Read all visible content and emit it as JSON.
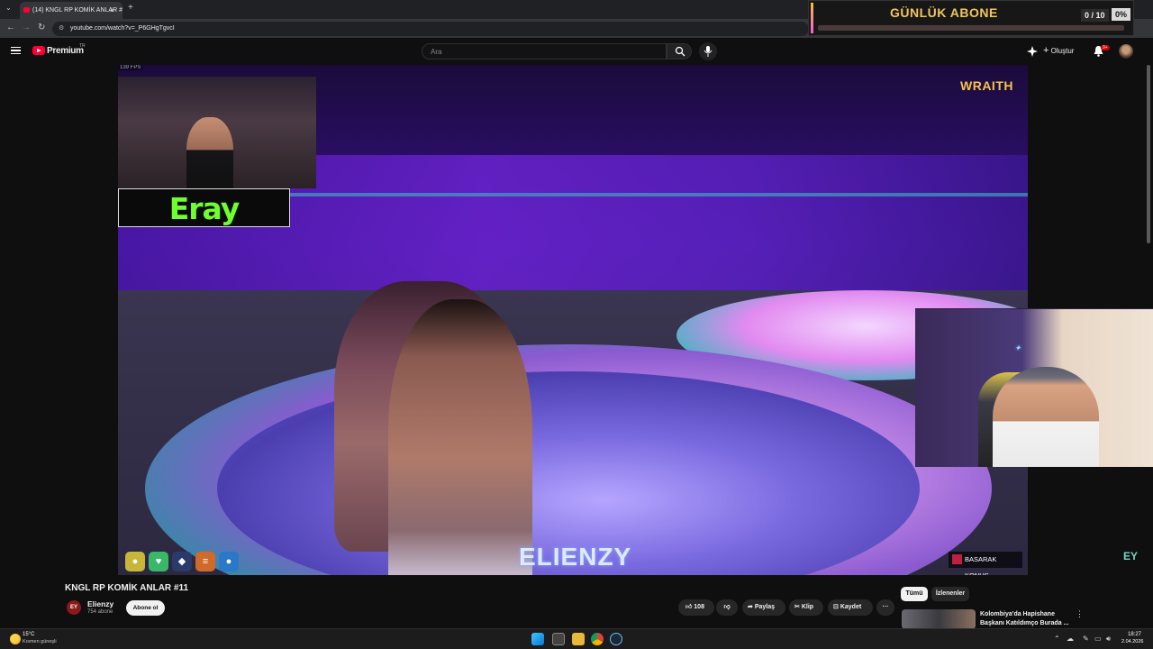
{
  "browser": {
    "tab_title": "(14) KNGL RP KOMİK ANLAR #",
    "url": "youtube.com/watch?v=_P6GHgTgvcI"
  },
  "overlay": {
    "title": "GÜNLÜK ABONE",
    "count": "0 / 10",
    "percent": "0%",
    "progress": 0
  },
  "header": {
    "brand": "Premium",
    "country": "TR",
    "search_placeholder": "Ara",
    "create_label": "Oluştur",
    "notification_count": "9+"
  },
  "video": {
    "fps": "139 FPS",
    "streamer_name": "Eray",
    "sponsor": "WRAITH",
    "character_name": "ELIENZY",
    "speaking_label": "BASARAK KONUŞ",
    "channel_mark": "EY"
  },
  "details": {
    "title": "KNGL RP KOMİK ANLAR #11",
    "channel": "Elienzy",
    "channel_avatar_text": "EY",
    "subscribers": "754 abone",
    "subscribe_label": "Abone ol",
    "likes": "108",
    "share_label": "Paylaş",
    "clip_label": "Klip",
    "save_label": "Kaydet"
  },
  "sidebar": {
    "chips": [
      "Tümü",
      "İzlenenler"
    ],
    "recommendation_title": "Kolombiya'da Hapishane Başkanı Katıldımço Burada ..."
  },
  "taskbar": {
    "temperature": "15°C",
    "weather": "Kısmen güneşli",
    "time": "18:27",
    "date": "2.04.2026"
  },
  "colors": {
    "youtube_red": "#ff0033",
    "name_green": "#6dff2e",
    "overlay_gold": "#f4c55a"
  }
}
